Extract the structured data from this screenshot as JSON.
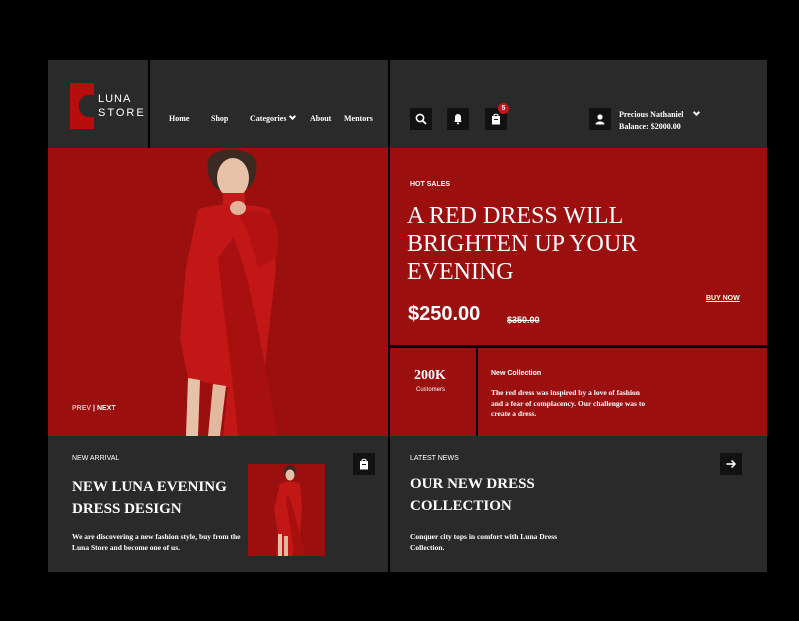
{
  "brand": {
    "line1": "LUNA",
    "line2": "STORE",
    "accent": "#b70d0d"
  },
  "nav": {
    "items": [
      {
        "label": "Home"
      },
      {
        "label": "Shop"
      },
      {
        "label": "Categories",
        "has_dropdown": true
      },
      {
        "label": "About"
      },
      {
        "label": "Mentors"
      }
    ]
  },
  "header_icons": {
    "search": "search-icon",
    "notifications": "bell-icon",
    "cart": "shopping-bag-icon",
    "cart_count": "5"
  },
  "user": {
    "name": "Precious Nathaniel",
    "balance": "Balance: $2000.00"
  },
  "hero": {
    "tag": "HOT SALES",
    "title": "A RED DRESS WILL BRIGHTEN UP YOUR EVENING",
    "price": "$250.00",
    "old_price": "$350.00",
    "cta": "BUY NOW",
    "prev": "PREV",
    "divider": "|",
    "next": "NEXT"
  },
  "stats": {
    "value": "200K",
    "label": "Customers"
  },
  "collection": {
    "title": "New Collection",
    "description": "The red dress was inspired by a love of fashion and a fear of complacency. Our challenge was to create a dress."
  },
  "new_arrival": {
    "tag": "NEW ARRIVAL",
    "title": "NEW LUNA EVENING DRESS DESIGN",
    "description": "We are discovering a new fashion style, buy from the Luna  Store and become one of us."
  },
  "latest_news": {
    "tag": "LATEST NEWS",
    "title": "OUR NEW DRESS COLLECTION",
    "description": "Conquer city tops in comfort with Luna Dress Collection."
  },
  "colors": {
    "panel": "#2a2a2a",
    "red": "#9c0f0f",
    "badge": "#c8141a",
    "background": "#000000"
  }
}
